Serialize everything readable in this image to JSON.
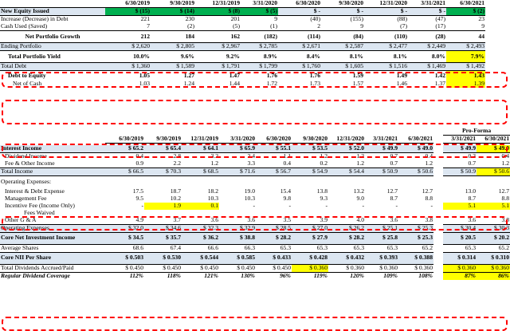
{
  "top": {
    "dates": [
      "6/30/2019",
      "9/30/2019",
      "12/31/2019",
      "3/31/2020",
      "6/30/2020",
      "9/30/2020",
      "12/31/2020",
      "3/31/2021",
      "6/30/2021"
    ],
    "rows": [
      {
        "label": "New Equity Issued",
        "cells": [
          "$ (15)",
          "$ (14)",
          "$ (8)",
          "$ (5)",
          "$ -",
          "$ -",
          "$ -",
          "$ -",
          "$ (2)"
        ]
      },
      {
        "label": "Increase (Decrease) in Debt",
        "cells": [
          "221",
          "230",
          "201",
          "9",
          "(40)",
          "(155)",
          "(88)",
          "(47)",
          "23"
        ]
      },
      {
        "label": "Cash Used (Saved)",
        "cells": [
          "7",
          "(2)",
          "(5)",
          "(1)",
          "2",
          "9",
          "(7)",
          "(17)",
          "9"
        ]
      },
      {
        "label": "Net Portfolio Growth",
        "cells": [
          "212",
          "184",
          "162",
          "(182)",
          "(114)",
          "(84)",
          "(110)",
          "(28)",
          "44"
        ]
      },
      {
        "label": "Ending Portfolio",
        "cells": [
          "$ 2,620",
          "$ 2,805",
          "$ 2,967",
          "$ 2,785",
          "$ 2,671",
          "$ 2,587",
          "$ 2,477",
          "$ 2,449",
          "$ 2,493"
        ]
      },
      {
        "label": "Total Portfolio Yield",
        "cells": [
          "10.0%",
          "9.6%",
          "9.2%",
          "8.9%",
          "8.4%",
          "8.1%",
          "8.1%",
          "8.0%",
          "7.9%"
        ]
      },
      {
        "label": "Total Debt",
        "cells": [
          "$ 1,360",
          "$ 1,589",
          "$ 1,791",
          "$ 1,799",
          "$ 1,760",
          "$ 1,605",
          "$ 1,516",
          "$ 1,469",
          "$ 1,492"
        ]
      },
      {
        "label": "Debt to Equity",
        "cells": [
          "1.05",
          "1.27",
          "1.47",
          "1.76",
          "1.76",
          "1.59",
          "1.49",
          "1.42",
          "1.43"
        ]
      },
      {
        "label": "Net of Cash",
        "cells": [
          "1.03",
          "1.24",
          "1.44",
          "1.72",
          "1.73",
          "1.57",
          "1.46",
          "1.37",
          "1.39"
        ]
      }
    ]
  },
  "bottom": {
    "dates": [
      "6/30/2019",
      "9/30/2019",
      "12/31/2019",
      "3/31/2020",
      "6/30/2020",
      "9/30/2020",
      "12/31/2020",
      "3/31/2021",
      "6/30/2021"
    ],
    "proforma_title": "Pro-Forma",
    "proforma_dates": [
      "3/31/2021",
      "6/30/2021"
    ],
    "rows": [
      {
        "label": "Interest Income",
        "cells": [
          "$ 65.2",
          "$ 65.4",
          "$ 64.1",
          "$ 65.9",
          "$ 55.1",
          "$ 53.5",
          "$ 52.0",
          "$ 49.9",
          "$ 49.0"
        ],
        "pf": [
          "$ 49.9",
          "$ 49.0"
        ]
      },
      {
        "label": "Dividend Income",
        "cells": [
          "0.4",
          "2.8",
          "3.2",
          "2.4",
          "1.1",
          "1.2",
          "1.2",
          "0.7",
          "0.4"
        ],
        "pf": [
          "0.3",
          "0.4"
        ]
      },
      {
        "label": "Fee & Other Income",
        "cells": [
          "0.9",
          "2.2",
          "1.2",
          "3.3",
          "0.4",
          "0.2",
          "1.2",
          "0.7",
          "1.2"
        ],
        "pf": [
          "0.7",
          "1.2"
        ]
      },
      {
        "label": "Total Income",
        "cells": [
          "$ 66.5",
          "$ 70.3",
          "$ 68.5",
          "$ 71.6",
          "$ 56.7",
          "$ 54.9",
          "$ 54.4",
          "$ 50.9",
          "$ 50.6"
        ],
        "pf": [
          "$ 50.9",
          "$ 50.6"
        ]
      },
      {
        "label": "Operating Expenses:",
        "cells": [
          "",
          "",
          "",
          "",
          "",
          "",
          "",
          "",
          ""
        ],
        "pf": [
          "",
          ""
        ]
      },
      {
        "label": "Interest & Debt Expense",
        "cells": [
          "17.5",
          "18.7",
          "18.2",
          "19.0",
          "15.4",
          "13.8",
          "13.2",
          "12.7",
          "12.7"
        ],
        "pf": [
          "13.0",
          "12.7"
        ]
      },
      {
        "label": "Management Fee",
        "cells": [
          "9.5",
          "10.2",
          "10.3",
          "10.3",
          "9.8",
          "9.3",
          "9.0",
          "8.7",
          "8.8"
        ],
        "pf": [
          "8.7",
          "8.8"
        ]
      },
      {
        "label": "Incentive Fee (Income Only)",
        "cells": [
          "-",
          "1.9",
          "0.1",
          "-",
          "-",
          "-",
          "-",
          "-",
          "-"
        ],
        "pf": [
          "5.1",
          "5.1"
        ]
      },
      {
        "label": "Fees Waived",
        "cells": [
          "",
          "",
          "",
          "",
          "",
          "",
          "",
          "",
          ""
        ],
        "pf": [
          "",
          ""
        ]
      },
      {
        "label": "Other G & A",
        "cells": [
          "4.9",
          "3.7",
          "3.6",
          "3.6",
          "3.5",
          "3.9",
          "4.0",
          "3.6",
          "3.8"
        ],
        "pf": [
          "3.6",
          "3.8"
        ]
      },
      {
        "label": "Operating Expenses",
        "cells": [
          "$ 32.0",
          "$ 34.6",
          "$ 32.3",
          "$ 32.9",
          "$ 28.5",
          "$ 27.0",
          "$ 26.2",
          "$ 25.1",
          "$ 25.3"
        ],
        "pf": [
          "$ 30.4",
          "$ 30.3"
        ]
      },
      {
        "label": "Core Net Investment Income",
        "cells": [
          "$ 34.5",
          "$ 35.7",
          "$ 36.2",
          "$ 38.8",
          "$ 28.2",
          "$ 27.9",
          "$ 28.2",
          "$ 25.8",
          "$ 25.3"
        ],
        "pf": [
          "$ 20.5",
          "$ 20.2"
        ]
      },
      {
        "label": "Average Shares",
        "cells": [
          "68.6",
          "67.4",
          "66.6",
          "66.3",
          "65.3",
          "65.3",
          "65.3",
          "65.3",
          "65.2"
        ],
        "pf": [
          "65.3",
          "65.2"
        ]
      },
      {
        "label": "Core NII Per Share",
        "cells": [
          "$ 0.503",
          "$ 0.530",
          "$ 0.544",
          "$ 0.585",
          "$ 0.433",
          "$ 0.428",
          "$ 0.432",
          "$ 0.393",
          "$ 0.388"
        ],
        "pf": [
          "$ 0.314",
          "$ 0.310"
        ]
      },
      {
        "label": "Total Dividends Accrued/Paid",
        "cells": [
          "$ 0.450",
          "$ 0.450",
          "$ 0.450",
          "$ 0.450",
          "$ 0.450",
          "$ 0.360",
          "$ 0.360",
          "$ 0.360",
          "$ 0.360"
        ],
        "pf": [
          "$ 0.360",
          "$ 0.360"
        ]
      },
      {
        "label": "Regular Dividend Coverage",
        "cells": [
          "112%",
          "118%",
          "121%",
          "130%",
          "96%",
          "119%",
          "120%",
          "109%",
          "108%"
        ],
        "pf": [
          "87%",
          "86%"
        ]
      }
    ]
  },
  "colors": {
    "green": "#00b050",
    "yellow": "#ffff00",
    "blue": "#dce6f1",
    "red_dash": "#ff0000"
  }
}
